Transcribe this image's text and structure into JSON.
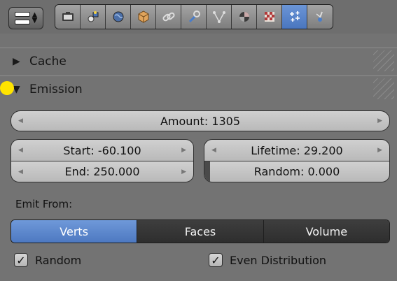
{
  "toolbar": {
    "tabs": [
      {
        "icon": "camera-render-icon",
        "active": false
      },
      {
        "icon": "render-layers-icon",
        "active": false
      },
      {
        "icon": "scene-icon",
        "active": false
      },
      {
        "icon": "world-icon",
        "active": false
      },
      {
        "icon": "object-cube-icon",
        "active": false
      },
      {
        "icon": "constraints-link-icon",
        "active": false
      },
      {
        "icon": "modifiers-wrench-icon",
        "active": false
      },
      {
        "icon": "object-data-icon",
        "active": false
      },
      {
        "icon": "material-icon",
        "active": false
      },
      {
        "icon": "texture-checker-icon",
        "active": false
      },
      {
        "icon": "particles-icon",
        "active": true
      },
      {
        "icon": "physics-icon",
        "active": false
      }
    ]
  },
  "panels": {
    "cache": {
      "title": "Cache",
      "expanded": false
    },
    "emission": {
      "title": "Emission",
      "expanded": true
    }
  },
  "emission": {
    "amount": "Amount: 1305",
    "start": "Start: -60.100",
    "end": "End: 250.000",
    "lifetime": "Lifetime: 29.200",
    "random": "Random: 0.000",
    "random_value": 0.0,
    "emit_from_label": "Emit From:",
    "emit_from_options": [
      "Verts",
      "Faces",
      "Volume"
    ],
    "emit_from_selected": "Verts",
    "checkbox_random": {
      "label": "Random",
      "checked": true
    },
    "checkbox_even": {
      "label": "Even Distribution",
      "checked": true
    }
  },
  "colors": {
    "background": "#737373",
    "accent": "#5a85cc",
    "cursor": "#ffe400"
  }
}
